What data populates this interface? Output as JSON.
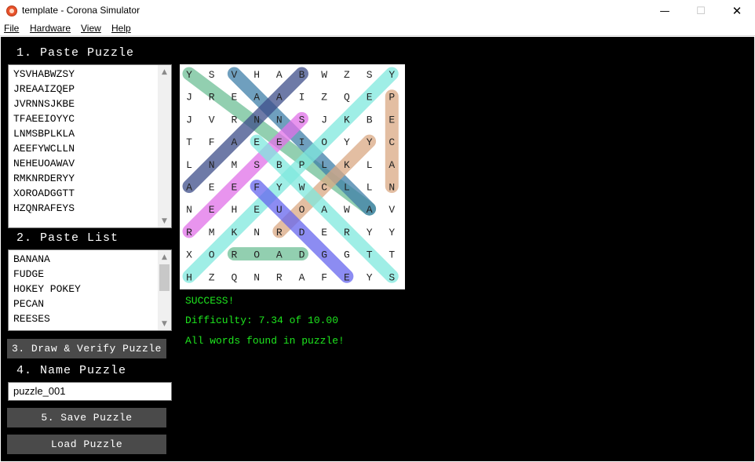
{
  "window": {
    "title": "template - Corona Simulator",
    "icon": "corona-icon",
    "controls": {
      "minimize": "—",
      "maximize": "☐",
      "close": "✕"
    }
  },
  "menu": [
    "File",
    "Hardware",
    "View",
    "Help"
  ],
  "sections": {
    "paste_puzzle": "1. Paste Puzzle",
    "paste_list": "2. Paste List",
    "name_puzzle": "4. Name Puzzle"
  },
  "puzzle_text_lines": [
    "YSVHABWZSY",
    "JREAAIZQEP",
    "JVRNNSJKBE",
    "TFAEEIOYYC",
    "LNMSBPLKLA",
    "AEEFYWCLLN",
    "NEHEUOAWAV",
    "RMKNRDERYY",
    "XOROADGGTT",
    "HZQNRAFEYS"
  ],
  "word_list_lines": [
    "BANANA",
    "FUDGE",
    "HOKEY POKEY",
    "PECAN",
    "REESES"
  ],
  "buttons": {
    "draw_verify": "3. Draw & Verify Puzzle",
    "save": "5. Save Puzzle",
    "load": "Load Puzzle"
  },
  "name_input_value": "puzzle_001",
  "status": {
    "success": "SUCCESS!",
    "difficulty": "Difficulty: 7.34 of 10.00",
    "found": "All words found in puzzle!"
  },
  "grid": {
    "rows": [
      "YSVHABWZSY",
      "JREAAIZQEP",
      "JVRNNSJKBE",
      "TFAEEIOYYC",
      "LNMSBPLKLA",
      "AEEFYWCLLN",
      "NEHEUOAWAV",
      "RMKNRDERYY",
      "XOROADGGTT",
      "HZQNRAFEYS"
    ],
    "highlights": [
      {
        "from": [
          0,
          0
        ],
        "to": [
          6,
          8
        ],
        "color": "#6dbf95"
      },
      {
        "from": [
          0,
          2
        ],
        "to": [
          6,
          8
        ],
        "color": "#3f7fa8"
      },
      {
        "from": [
          0,
          5
        ],
        "to": [
          5,
          0
        ],
        "color": "#3d4d8a"
      },
      {
        "from": [
          0,
          9
        ],
        "to": [
          9,
          0
        ],
        "color": "#7fe8dd"
      },
      {
        "from": [
          1,
          9
        ],
        "to": [
          5,
          9
        ],
        "color": "#d9a883"
      },
      {
        "from": [
          2,
          5
        ],
        "to": [
          7,
          0
        ],
        "color": "#e070e8"
      },
      {
        "from": [
          3,
          8
        ],
        "to": [
          7,
          4
        ],
        "color": "#d9a883"
      },
      {
        "from": [
          5,
          3
        ],
        "to": [
          9,
          7
        ],
        "color": "#6666ee"
      },
      {
        "from": [
          8,
          2
        ],
        "to": [
          8,
          5
        ],
        "color": "#6dbf95"
      },
      {
        "from": [
          3,
          3
        ],
        "to": [
          9,
          9
        ],
        "color": "#7fe8dd"
      }
    ]
  }
}
